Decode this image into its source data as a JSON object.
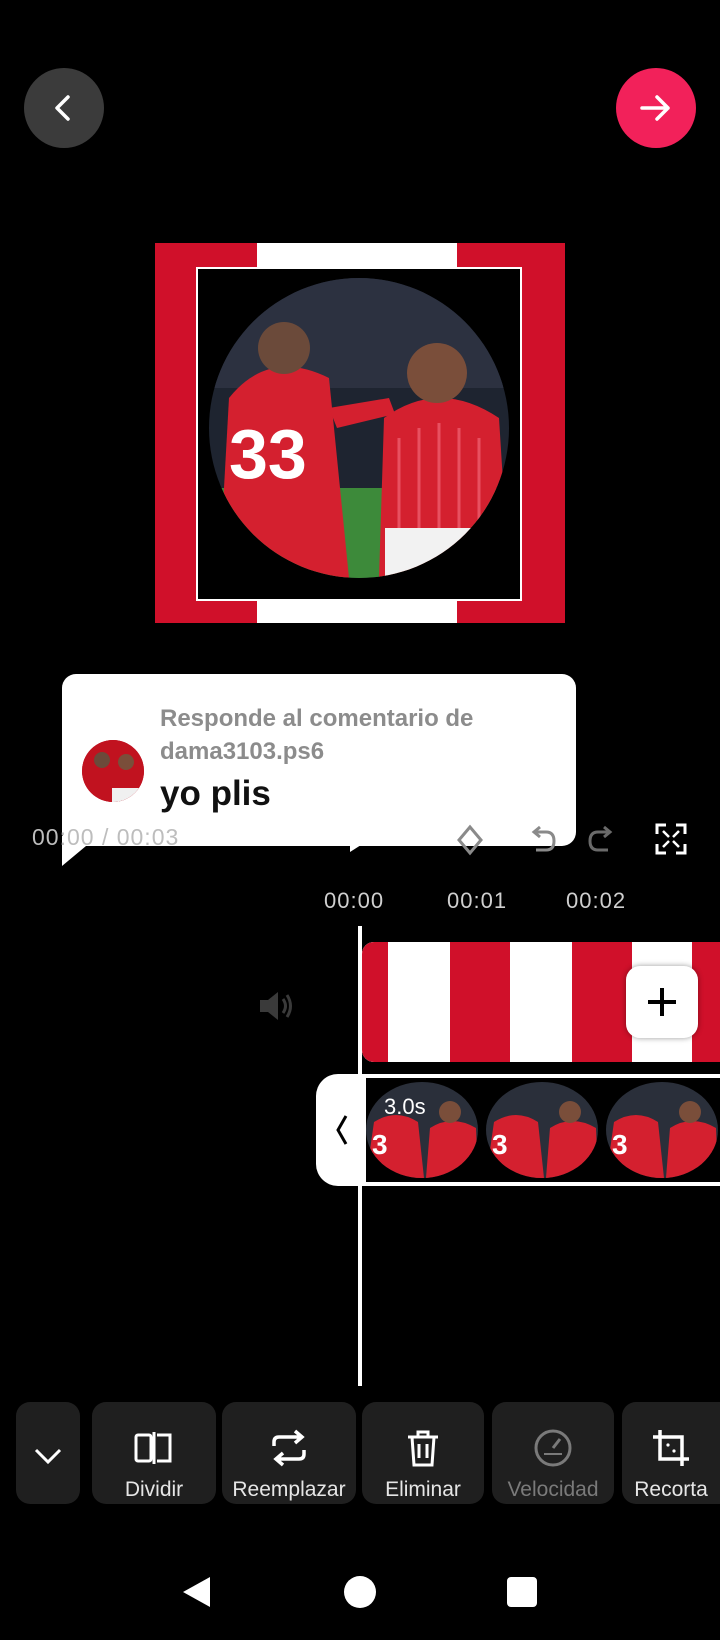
{
  "comment": {
    "title": "Responde al comentario de dama3103.ps6",
    "text": "yo plis"
  },
  "playback": {
    "time_readout": "00:00 / 00:03"
  },
  "ruler": [
    "00:00",
    "00:01",
    "00:02"
  ],
  "timeline": {
    "clip_duration": "3.0s"
  },
  "tools": [
    {
      "label": "Dividir",
      "icon": "split-icon",
      "enabled": true
    },
    {
      "label": "Reemplazar",
      "icon": "replace-icon",
      "enabled": true
    },
    {
      "label": "Eliminar",
      "icon": "trash-icon",
      "enabled": true
    },
    {
      "label": "Velocidad",
      "icon": "speed-icon",
      "enabled": false
    },
    {
      "label": "Recorta",
      "icon": "crop-icon",
      "enabled": true
    }
  ],
  "colors": {
    "accent": "#f2215a",
    "team_red": "#d0102a"
  }
}
